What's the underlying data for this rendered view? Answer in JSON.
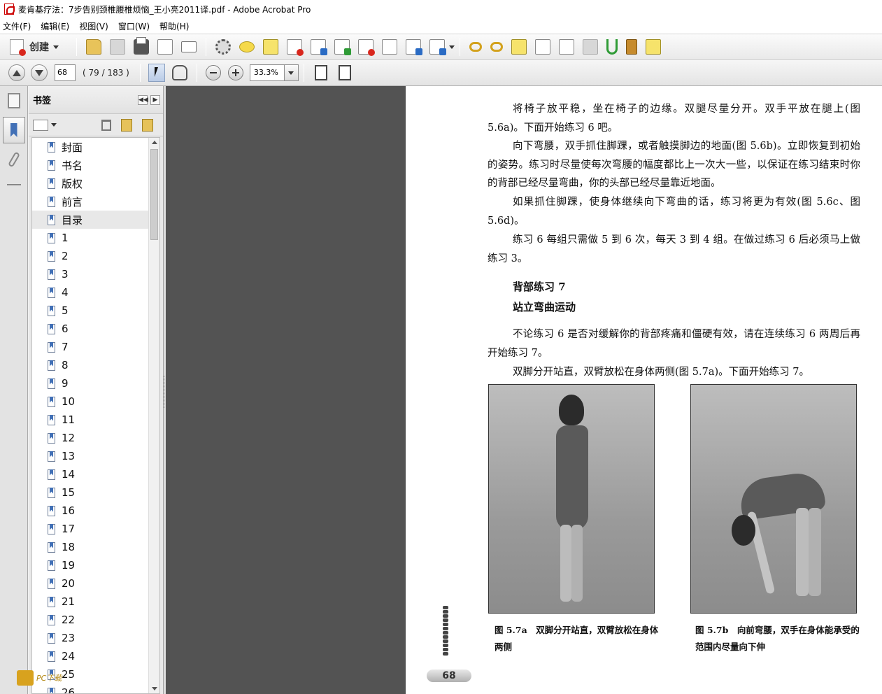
{
  "window": {
    "title": "麦肯基疗法：7步告别颈椎腰椎烦恼_王小亮2011译.pdf - Adobe Acrobat Pro"
  },
  "menu": [
    "文件(F)",
    "编辑(E)",
    "视图(V)",
    "窗口(W)",
    "帮助(H)"
  ],
  "toolbar": {
    "create_label": "创建"
  },
  "navigation": {
    "page_input": "68",
    "page_count": "( 79 / 183 )",
    "zoom": "33.3%"
  },
  "bookmarks_panel": {
    "title": "书签",
    "items": [
      "封面",
      "书名",
      "版权",
      "前言",
      "目录",
      "1",
      "2",
      "3",
      "4",
      "5",
      "6",
      "7",
      "8",
      "9",
      "10",
      "11",
      "12",
      "13",
      "14",
      "15",
      "16",
      "17",
      "18",
      "19",
      "20",
      "21",
      "22",
      "23",
      "24",
      "25",
      "26"
    ],
    "selected_index": 4
  },
  "document": {
    "paragraphs": [
      "将椅子放平稳，坐在椅子的边缘。双腿尽量分开。双手平放在腿上(图 5.6a)。下面开始练习 6 吧。",
      "向下弯腰，双手抓住脚踝，或者触摸脚边的地面(图 5.6b)。立即恢复到初始的姿势。练习时尽量使每次弯腰的幅度都比上一次大一些，以保证在练习结束时你的背部已经尽量弯曲，你的头部已经尽量靠近地面。",
      "如果抓住脚踝，使身体继续向下弯曲的话，练习将更为有效(图 5.6c、图 5.6d)。",
      "练习 6 每组只需做 5 到 6 次，每天 3 到 4 组。在做过练习 6 后必须马上做练习 3。"
    ],
    "heading1": "背部练习 7",
    "heading2": "站立弯曲运动",
    "paragraphs2": [
      "不论练习 6 是否对缓解你的背部疼痛和僵硬有效，请在连续练习 6 两周后再开始练习 7。",
      "双脚分开站直，双臂放松在身体两侧(图 5.7a)。下面开始练习 7。"
    ],
    "caption_a": "图 5.7a　双脚分开站直，双臂放松在身体两侧",
    "caption_b": "图 5.7b　向前弯腰，双手在身体能承受的范围内尽量向下伸",
    "page_number": "68"
  },
  "watermark": {
    "text": "PC下载"
  }
}
